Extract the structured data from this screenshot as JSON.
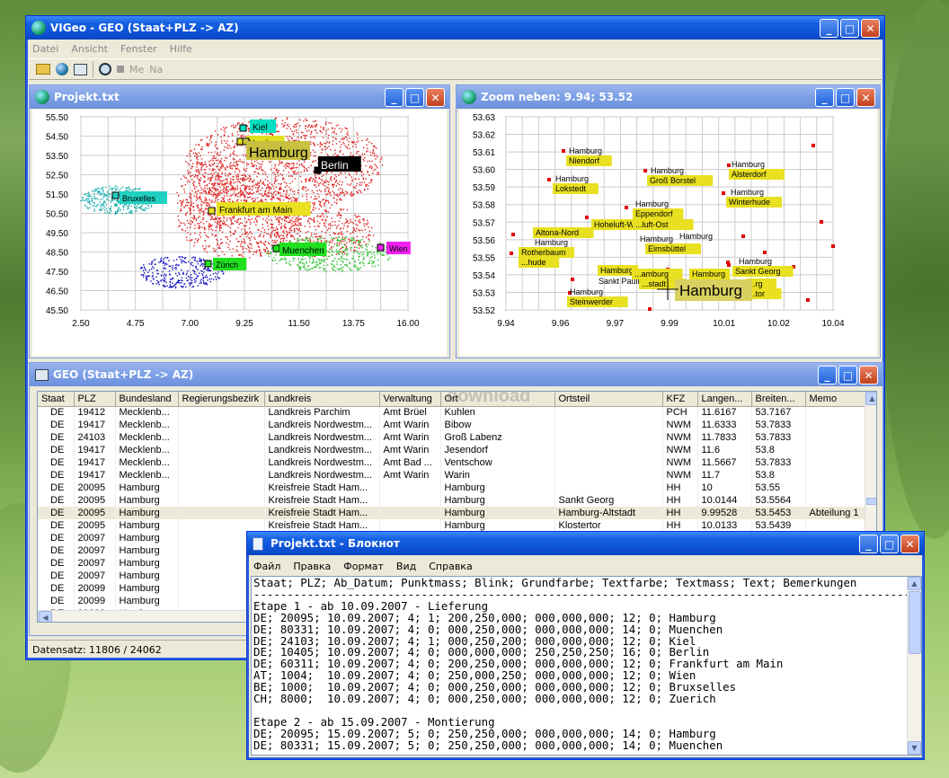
{
  "main": {
    "title": "VIGeo - GEO (Staat+PLZ -> AZ)",
    "menu": [
      "Datei",
      "Ansicht",
      "Fenster",
      "Hilfe"
    ],
    "toolbar": {
      "me": "Me",
      "na": "Na"
    },
    "status": "Datensatz:  11806 /  24062"
  },
  "map": {
    "title": "Projekt.txt",
    "yticks": [
      "55.50",
      "54.50",
      "53.50",
      "52.50",
      "51.50",
      "50.50",
      "49.50",
      "48.50",
      "47.50",
      "46.50",
      "45.50"
    ],
    "xticks": [
      "2.50",
      "4.75",
      "7.00",
      "9.25",
      "11.50",
      "13.75",
      "16.00"
    ],
    "labels": [
      {
        "t": "Kiel"
      },
      {
        "t": "Hamburg"
      },
      {
        "t": "Hamburg"
      },
      {
        "t": "Berlin"
      },
      {
        "t": "Bruxelles"
      },
      {
        "t": "Frankfurt am Main"
      },
      {
        "t": "Muenchen"
      },
      {
        "t": "Wien"
      },
      {
        "t": "Zürich"
      }
    ]
  },
  "zoom": {
    "title": "Zoom neben: 9.94; 53.52",
    "yticks": [
      "53.63",
      "53.62",
      "53.61",
      "53.60",
      "53.59",
      "53.58",
      "53.57",
      "53.56",
      "53.55",
      "53.54",
      "53.53",
      "53.52"
    ],
    "xticks": [
      "9.94",
      "9.96",
      "9.97",
      "9.99",
      "10.01",
      "10.02",
      "10.04"
    ],
    "labels": [
      "Hamburg",
      "Niendorf",
      "Hamburg",
      "Lokstedt",
      "Hamburg",
      "Groß Borstel",
      "Hamburg",
      "Alsterdorf",
      "Hamburg",
      "Winterhude",
      "Hamburg",
      "Eppendorf",
      "Hoheluft-West",
      "...luft-Ost",
      "Hamburg",
      "Eimsbüttel",
      "Hamburg",
      "Altona-Nord",
      "Hamburg",
      "Rotherbaum",
      "...hude",
      "Hamburg",
      "Sankt Pauli",
      "...amburg",
      "...stadt",
      "Hamburg",
      "Hamburg",
      "Sankt Georg",
      "Hamburg",
      "Steinwerder",
      "...rg",
      "...tor"
    ],
    "big": "Hamburg"
  },
  "grid": {
    "title": "GEO (Staat+PLZ -> AZ)",
    "watermark": "download",
    "headers": [
      "Staat",
      "PLZ",
      "Bundesland",
      "Regierungsbezirk",
      "Landkreis",
      "Verwaltung",
      "Ort",
      "Ortsteil",
      "KFZ",
      "Langen...",
      "Breiten...",
      "Memo"
    ],
    "rows": [
      [
        "DE",
        "19412",
        "Mecklenb...",
        "",
        "Landkreis Parchim",
        "Amt Brüel",
        "Kuhlen",
        "",
        "PCH",
        "11.6167",
        "53.7167",
        ""
      ],
      [
        "DE",
        "19417",
        "Mecklenb...",
        "",
        "Landkreis Nordwestm...",
        "Amt Warin",
        "Bibow",
        "",
        "NWM",
        "11.6333",
        "53.7833",
        ""
      ],
      [
        "DE",
        "24103",
        "Mecklenb...",
        "",
        "Landkreis Nordwestm...",
        "Amt Warin",
        "Groß Labenz",
        "",
        "NWM",
        "11.7833",
        "53.7833",
        ""
      ],
      [
        "DE",
        "19417",
        "Mecklenb...",
        "",
        "Landkreis Nordwestm...",
        "Amt Warin",
        "Jesendorf",
        "",
        "NWM",
        "11.6",
        "53.8",
        ""
      ],
      [
        "DE",
        "19417",
        "Mecklenb...",
        "",
        "Landkreis Nordwestm...",
        "Amt Bad ...",
        "Ventschow",
        "",
        "NWM",
        "11.5667",
        "53.7833",
        ""
      ],
      [
        "DE",
        "19417",
        "Mecklenb...",
        "",
        "Landkreis Nordwestm...",
        "Amt Warin",
        "Warin",
        "",
        "NWM",
        "11.7",
        "53.8",
        ""
      ],
      [
        "DE",
        "20095",
        "Hamburg",
        "",
        "Kreisfreie Stadt Ham...",
        "",
        "Hamburg",
        "",
        "HH",
        "10",
        "53.55",
        ""
      ],
      [
        "DE",
        "20095",
        "Hamburg",
        "",
        "Kreisfreie Stadt Ham...",
        "",
        "Hamburg",
        "Sankt Georg",
        "HH",
        "10.0144",
        "53.5564",
        ""
      ],
      [
        "DE",
        "20095",
        "Hamburg",
        "",
        "Kreisfreie Stadt Ham...",
        "",
        "Hamburg",
        "Hamburg-Altstadt",
        "HH",
        "9.99528",
        "53.5453",
        "Abteilung 1"
      ],
      [
        "DE",
        "20095",
        "Hamburg",
        "",
        "Kreisfreie Stadt Ham...",
        "",
        "Hamburg",
        "Klostertor",
        "HH",
        "10.0133",
        "53.5439",
        ""
      ],
      [
        "DE",
        "20097",
        "Hamburg",
        "",
        "",
        "",
        "",
        "",
        "",
        "",
        "",
        ""
      ],
      [
        "DE",
        "20097",
        "Hamburg",
        "",
        "",
        "",
        "",
        "",
        "",
        "",
        "",
        ""
      ],
      [
        "DE",
        "20097",
        "Hamburg",
        "",
        "",
        "",
        "",
        "",
        "",
        "",
        "",
        ""
      ],
      [
        "DE",
        "20097",
        "Hamburg",
        "",
        "",
        "",
        "",
        "",
        "",
        "",
        "",
        ""
      ],
      [
        "DE",
        "20099",
        "Hamburg",
        "",
        "",
        "",
        "",
        "",
        "",
        "",
        "",
        ""
      ],
      [
        "DE",
        "20099",
        "Hamburg",
        "",
        "",
        "",
        "",
        "",
        "",
        "",
        "",
        ""
      ],
      [
        "DE",
        "20099",
        "Hamburg",
        "",
        "",
        "",
        "",
        "",
        "",
        "",
        "",
        ""
      ]
    ]
  },
  "notepad": {
    "title": "Projekt.txt - Блокнот",
    "menu": [
      "Файл",
      "Правка",
      "Формат",
      "Вид",
      "Справка"
    ],
    "lines": [
      "Staat; PLZ; Ab_Datum; Punktmass; Blink; Grundfarbe; Textfarbe; Textmass; Text; Bemerkungen",
      "--------------------------------------------------------------------------------------------------",
      "Etape 1 - ab 10.09.2007 - Lieferung",
      "DE; 20095; 10.09.2007; 4; 1; 200,250,000; 000,000,000; 12; 0; Hamburg",
      "DE; 80331; 10.09.2007; 4; 0; 000,250,000; 000,000,000; 14; 0; Muenchen",
      "DE; 24103; 10.09.2007; 4; 1; 000,250,200; 000,000,000; 12; 0; Kiel",
      "DE; 10405; 10.09.2007; 4; 0; 000,000,000; 250,250,250; 16; 0; Berlin",
      "DE; 60311; 10.09.2007; 4; 0; 200,250,000; 000,000,000; 12; 0; Frankfurt am Main",
      "AT; 1004;  10.09.2007; 4; 0; 250,000,250; 000,000,000; 12; 0; Wien",
      "BE; 1000;  10.09.2007; 4; 0; 000,250,000; 000,000,000; 12; 0; Bruxselles",
      "CH; 8000;  10.09.2007; 4; 0; 000,250,000; 000,000,000; 12; 0; Zuerich",
      "",
      "Etape 2 - ab 15.09.2007 - Montierung",
      "DE; 20095; 15.09.2007; 5; 0; 250,250,000; 000,000,000; 14; 0; Hamburg",
      "DE; 80331; 15.09.2007; 5; 0; 250,250,000; 000,000,000; 14; 0; Muenchen"
    ]
  }
}
